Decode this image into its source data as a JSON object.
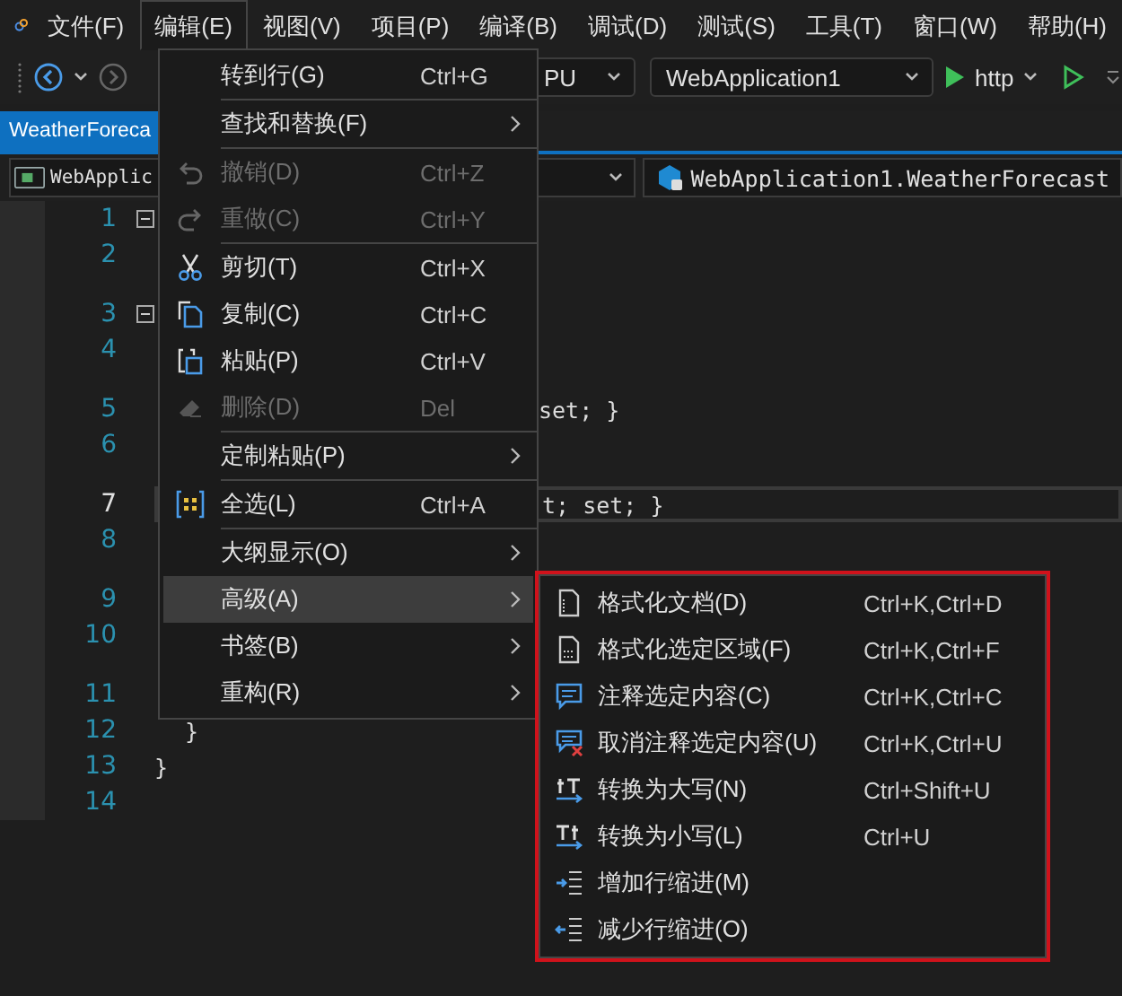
{
  "menubar": [
    {
      "label": "文件(F)",
      "selected": false
    },
    {
      "label": "编辑(E)",
      "selected": true
    },
    {
      "label": "视图(V)",
      "selected": false
    },
    {
      "label": "项目(P)",
      "selected": false
    },
    {
      "label": "编译(B)",
      "selected": false
    },
    {
      "label": "调试(D)",
      "selected": false
    },
    {
      "label": "测试(S)",
      "selected": false
    },
    {
      "label": "工具(T)",
      "selected": false
    },
    {
      "label": "窗口(W)",
      "selected": false
    },
    {
      "label": "帮助(H)",
      "selected": false
    }
  ],
  "toolbar": {
    "platform": "PU",
    "project": "WebApplication1",
    "run_target": "http"
  },
  "tabs": [
    {
      "label": "WeatherForeca",
      "selected": true
    }
  ],
  "nav": {
    "project": "WebApplic",
    "type": "WebApplication1.WeatherForecast"
  },
  "editor": {
    "lines": [
      {
        "number": "1",
        "fold": true,
        "current": false,
        "codelens_above": false
      },
      {
        "number": "2",
        "fold": false,
        "current": false,
        "codelens_above": false
      },
      {
        "number": "3",
        "fold": true,
        "current": false,
        "codelens_above": true
      },
      {
        "number": "4",
        "fold": false,
        "current": false,
        "codelens_above": false
      },
      {
        "number": "5",
        "fold": false,
        "current": false,
        "codelens_above": true,
        "kind": "clipped",
        "text": "set; }"
      },
      {
        "number": "6",
        "fold": false,
        "current": false,
        "codelens_above": false
      },
      {
        "number": "7",
        "fold": false,
        "current": true,
        "codelens_above": true,
        "kind": "clipped",
        "text": "t; set; }"
      },
      {
        "number": "8",
        "fold": false,
        "current": false,
        "codelens_above": false
      },
      {
        "number": "9",
        "fold": false,
        "current": false,
        "codelens_above": true
      },
      {
        "number": "10",
        "fold": false,
        "current": false,
        "codelens_above": false
      },
      {
        "number": "11",
        "fold": false,
        "current": false,
        "codelens_above": true
      },
      {
        "number": "12",
        "fold": false,
        "current": false,
        "codelens_above": false,
        "kind": "nested",
        "text": "}"
      },
      {
        "number": "13",
        "fold": false,
        "current": false,
        "codelens_above": false,
        "kind": "top",
        "text": "}"
      },
      {
        "number": "14",
        "fold": false,
        "current": false,
        "codelens_above": false
      }
    ]
  },
  "edit_menu": [
    {
      "kind": "command",
      "label": "转到行(G)",
      "shortcut": "Ctrl+G",
      "disabled": false,
      "selected": false,
      "submenu": false
    },
    {
      "kind": "separator"
    },
    {
      "kind": "command",
      "label": "查找和替换(F)",
      "disabled": false,
      "selected": false,
      "submenu": true
    },
    {
      "kind": "separator"
    },
    {
      "kind": "command",
      "label": "撤销(D)",
      "shortcut": "Ctrl+Z",
      "disabled": true,
      "selected": false,
      "submenu": false
    },
    {
      "kind": "command",
      "label": "重做(C)",
      "shortcut": "Ctrl+Y",
      "disabled": true,
      "selected": false,
      "submenu": false
    },
    {
      "kind": "separator"
    },
    {
      "kind": "command",
      "label": "剪切(T)",
      "shortcut": "Ctrl+X",
      "disabled": false,
      "selected": false,
      "submenu": false
    },
    {
      "kind": "command",
      "label": "复制(C)",
      "shortcut": "Ctrl+C",
      "disabled": false,
      "selected": false,
      "submenu": false
    },
    {
      "kind": "command",
      "label": "粘贴(P)",
      "shortcut": "Ctrl+V",
      "disabled": false,
      "selected": false,
      "submenu": false
    },
    {
      "kind": "command",
      "label": "删除(D)",
      "shortcut": "Del",
      "disabled": true,
      "selected": false,
      "submenu": false
    },
    {
      "kind": "separator"
    },
    {
      "kind": "command",
      "label": "定制粘贴(P)",
      "disabled": false,
      "selected": false,
      "submenu": true
    },
    {
      "kind": "separator"
    },
    {
      "kind": "command",
      "label": "全选(L)",
      "shortcut": "Ctrl+A",
      "disabled": false,
      "selected": false,
      "submenu": false
    },
    {
      "kind": "separator"
    },
    {
      "kind": "command",
      "label": "大纲显示(O)",
      "disabled": false,
      "selected": false,
      "submenu": true
    },
    {
      "kind": "command",
      "label": "高级(A)",
      "disabled": false,
      "selected": true,
      "submenu": true
    },
    {
      "kind": "command",
      "label": "书签(B)",
      "disabled": false,
      "selected": false,
      "submenu": true
    },
    {
      "kind": "command",
      "label": "重构(R)",
      "disabled": false,
      "selected": false,
      "submenu": true
    }
  ],
  "advanced_menu": {
    "highlighted": true,
    "items": [
      {
        "label": "格式化文档(D)",
        "shortcut": "Ctrl+K,Ctrl+D"
      },
      {
        "label": "格式化选定区域(F)",
        "shortcut": "Ctrl+K,Ctrl+F"
      },
      {
        "label": "注释选定内容(C)",
        "shortcut": "Ctrl+K,Ctrl+C"
      },
      {
        "label": "取消注释选定内容(U)",
        "shortcut": "Ctrl+K,Ctrl+U"
      },
      {
        "label": "转换为大写(N)",
        "shortcut": "Ctrl+Shift+U"
      },
      {
        "label": "转换为小写(L)",
        "shortcut": "Ctrl+U"
      },
      {
        "label": "增加行缩进(M)"
      },
      {
        "label": "减少行缩进(O)"
      }
    ]
  }
}
